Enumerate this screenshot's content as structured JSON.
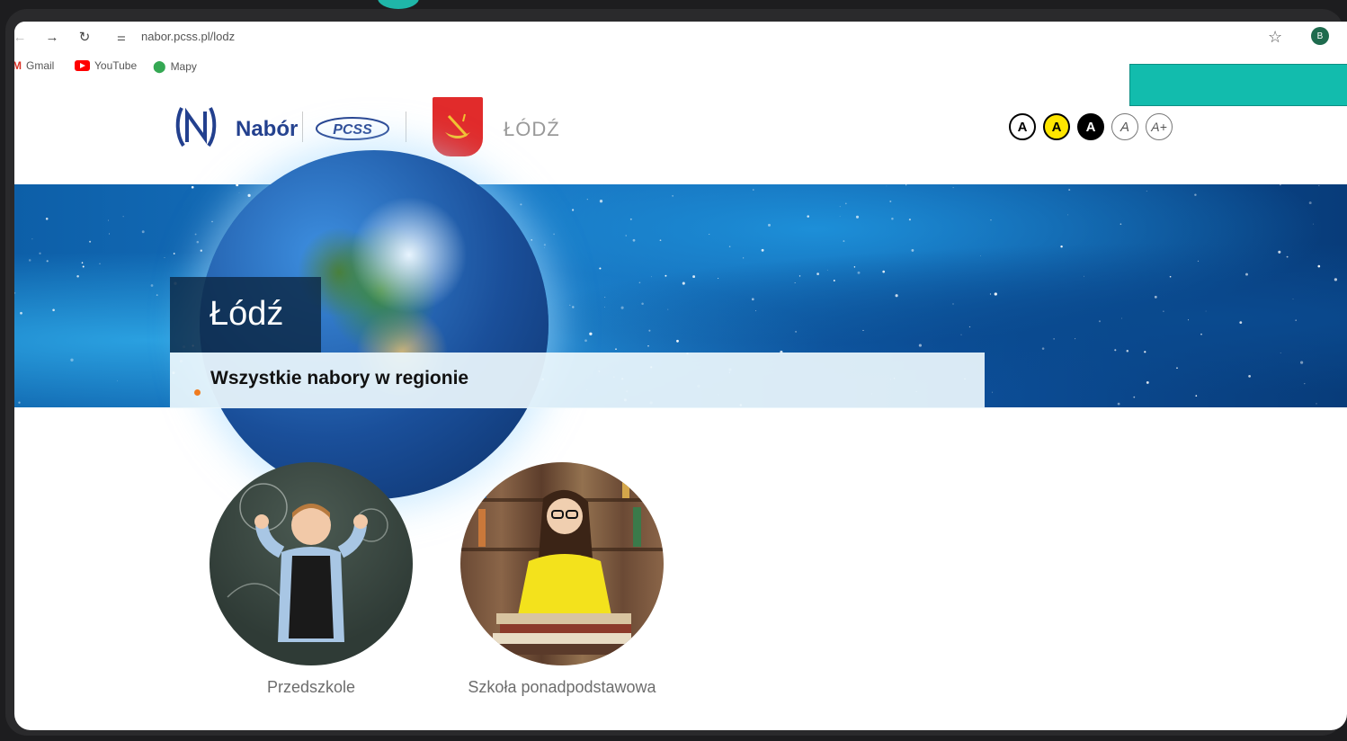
{
  "browser": {
    "url": "nabor.pcss.pl/lodz",
    "profile_initial": "B",
    "bookmarks": [
      {
        "label": "Gmail",
        "icon": "gmail-icon"
      },
      {
        "label": "YouTube",
        "icon": "youtube-icon"
      },
      {
        "label": "Mapy",
        "icon": "maps-icon"
      }
    ]
  },
  "header": {
    "brand": "Nabór",
    "pcss_logo_text": "PCSS",
    "city": "ŁÓDŹ",
    "accessibility_buttons": [
      {
        "label": "A",
        "name": "contrast-default",
        "bg": "#ffffff",
        "fg": "#000000",
        "border": "#000000"
      },
      {
        "label": "A",
        "name": "contrast-yellow",
        "bg": "#ffe600",
        "fg": "#000000",
        "border": "#000000"
      },
      {
        "label": "A",
        "name": "contrast-black",
        "bg": "#000000",
        "fg": "#ffffff",
        "border": "#000000"
      },
      {
        "label": "A",
        "name": "font-size-normal",
        "bg": "#ffffff",
        "fg": "#555555",
        "border": "#777777"
      },
      {
        "label": "A+",
        "name": "font-size-larger",
        "bg": "#ffffff",
        "fg": "#555555",
        "border": "#777777"
      }
    ]
  },
  "hero": {
    "title": "Łódź",
    "subtitle": "Wszystkie nabory w regionie"
  },
  "cards": [
    {
      "label": "Przedszkole",
      "image": "child-chalkboard"
    },
    {
      "label": "Szkoła ponadpodstawowa",
      "image": "student-library"
    }
  ],
  "colors": {
    "brand_blue": "#23408e",
    "accent_orange": "#f07b1f",
    "teal": "#12bcad"
  }
}
